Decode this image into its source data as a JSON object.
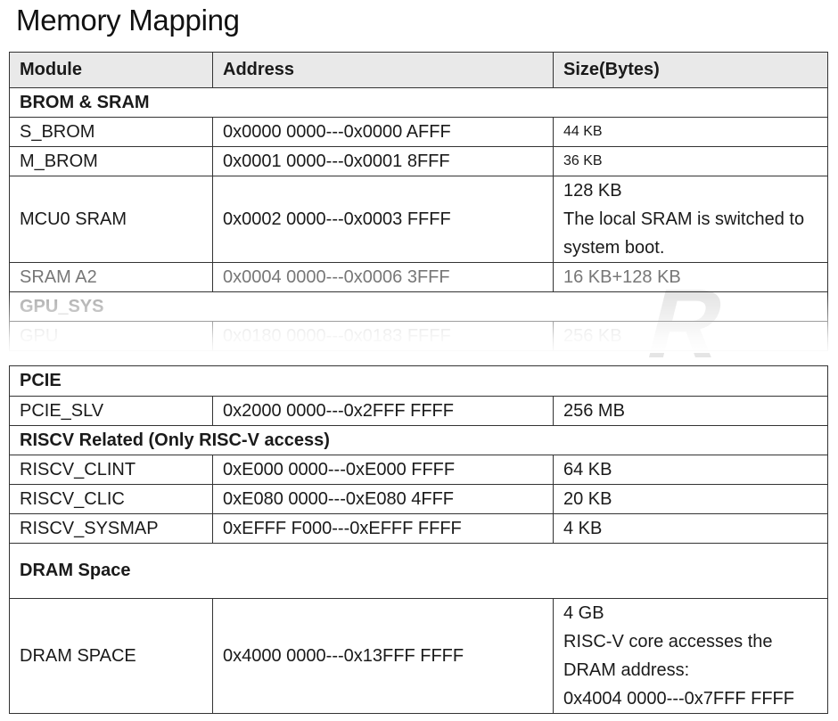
{
  "title": "Memory Mapping",
  "headers": {
    "module": "Module",
    "address": "Address",
    "size": "Size(Bytes)"
  },
  "sections_top": {
    "brom_sram": "BROM & SRAM",
    "gpu_sys": "GPU_SYS"
  },
  "rows_top": [
    {
      "module": "S_BROM",
      "address": "0x0000 0000---0x0000 AFFF",
      "size": "44 KB"
    },
    {
      "module": "M_BROM",
      "address": "0x0001 0000---0x0001 8FFF",
      "size": "36 KB"
    },
    {
      "module": "MCU0 SRAM",
      "address": "0x0002 0000---0x0003 FFFF",
      "size_lines": [
        "128 KB",
        "The local SRAM is switched to",
        "system boot."
      ]
    },
    {
      "module": "SRAM A2",
      "address": "0x0004 0000---0x0006 3FFF",
      "size": "16 KB+128 KB"
    },
    {
      "module": "GPU",
      "address": "0x0180 0000---0x0183 FFFF",
      "size": "256 KB"
    }
  ],
  "sections_bottom": {
    "pcie": "PCIE",
    "riscv": "RISCV Related (Only RISC-V access)",
    "dram": "DRAM Space"
  },
  "rows_bottom": [
    {
      "module": "PCIE_SLV",
      "address": "0x2000 0000---0x2FFF FFFF",
      "size": "256 MB"
    },
    {
      "module": "RISCV_CLINT",
      "address": "0xE000 0000---0xE000 FFFF",
      "size": "64 KB"
    },
    {
      "module": "RISCV_CLIC",
      "address": "0xE080 0000---0xE080 4FFF",
      "size": "20 KB"
    },
    {
      "module": "RISCV_SYSMAP",
      "address": "0xEFFF F000---0xEFFF FFFF",
      "size": "4 KB"
    },
    {
      "module": "DRAM SPACE",
      "address": "0x4000 0000---0x13FFF FFFF",
      "size_lines": [
        "4 GB",
        "RISC-V core accesses the",
        "DRAM address:",
        "0x4004 0000---0x7FFF FFFF"
      ]
    }
  ],
  "watermark_text": "R"
}
